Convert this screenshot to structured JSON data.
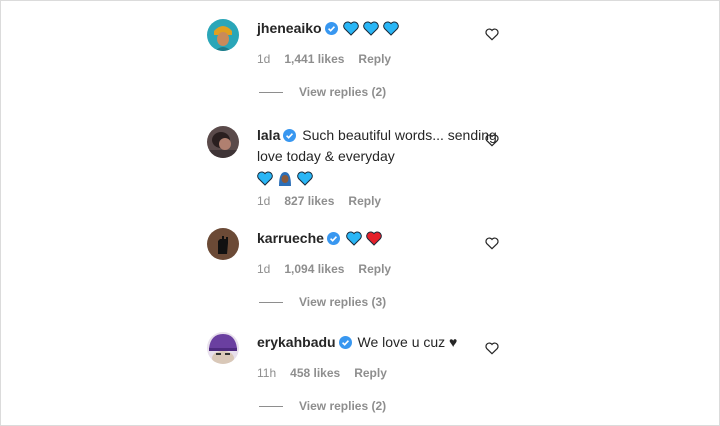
{
  "comments": [
    {
      "username": "jheneaiko",
      "text": "",
      "time": "1d",
      "likes": "1,441 likes",
      "reply": "Reply",
      "view_replies": "View replies (2)",
      "emojis": [
        "blue-heart",
        "blue-heart",
        "blue-heart"
      ]
    },
    {
      "username": "lala",
      "text": "Such beautiful words... sending love today & everyday",
      "time": "1d",
      "likes": "827 likes",
      "reply": "Reply",
      "emojis": [
        "blue-heart",
        "woman-with-headscarf",
        "blue-heart"
      ]
    },
    {
      "username": "karrueche",
      "text": "",
      "time": "1d",
      "likes": "1,094 likes",
      "reply": "Reply",
      "view_replies": "View replies (3)",
      "emojis": [
        "blue-heart",
        "red-heart"
      ]
    },
    {
      "username": "erykahbadu",
      "text": "We love u cuz ♥",
      "time": "11h",
      "likes": "458 likes",
      "reply": "Reply",
      "view_replies": "View replies (2)"
    }
  ],
  "colors": {
    "verified": "#3897f0",
    "blue_heart": "#29b6f6",
    "red_heart": "#e5202a",
    "muted": "#8e8e8e"
  }
}
